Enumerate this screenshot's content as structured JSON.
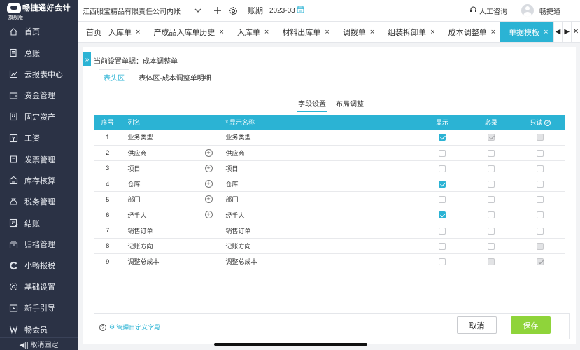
{
  "brand": {
    "name": "畅捷通好会计",
    "edition": "旗舰版"
  },
  "sidebar": {
    "items": [
      {
        "label": "首页",
        "icon": "home-icon"
      },
      {
        "label": "总账",
        "icon": "ledger-icon"
      },
      {
        "label": "云报表中心",
        "icon": "chart-icon"
      },
      {
        "label": "资金管理",
        "icon": "wallet-icon"
      },
      {
        "label": "固定资产",
        "icon": "building-icon"
      },
      {
        "label": "工资",
        "icon": "salary-icon"
      },
      {
        "label": "发票管理",
        "icon": "invoice-icon"
      },
      {
        "label": "库存核算",
        "icon": "warehouse-icon"
      },
      {
        "label": "税务管理",
        "icon": "tax-icon"
      },
      {
        "label": "结账",
        "icon": "checkout-icon"
      },
      {
        "label": "归档管理",
        "icon": "archive-icon"
      },
      {
        "label": "小畅报税",
        "icon": "c-logo-icon"
      },
      {
        "label": "基础设置",
        "icon": "gear-icon"
      },
      {
        "label": "新手引导",
        "icon": "guide-icon"
      },
      {
        "label": "畅会员",
        "icon": "member-icon"
      }
    ],
    "collapse_label": "◀|| 取消固定"
  },
  "header": {
    "company": "江西服宝精品有限责任公司内账",
    "period_label": "账期",
    "period_value": "2023-03",
    "support_label": "人工咨询",
    "username": "畅捷通"
  },
  "tabs": [
    {
      "label": "首页",
      "closable": false,
      "active": false
    },
    {
      "label": "入库单",
      "closable": true,
      "active": false,
      "clipped": true
    },
    {
      "label": "产成品入库单历史",
      "closable": true,
      "active": false
    },
    {
      "label": "入库单",
      "closable": true,
      "active": false
    },
    {
      "label": "材料出库单",
      "closable": true,
      "active": false
    },
    {
      "label": "调拨单",
      "closable": true,
      "active": false
    },
    {
      "label": "组装拆卸单",
      "closable": true,
      "active": false
    },
    {
      "label": "成本调整单",
      "closable": true,
      "active": false
    },
    {
      "label": "单据模板",
      "closable": true,
      "active": true
    }
  ],
  "panel": {
    "current_setting": "当前设置单据：成本调整单",
    "subtabs": [
      "表头区",
      "表体区-成本调整单明细"
    ],
    "modetabs": [
      "字段设置",
      "布局调整"
    ],
    "columns": [
      "序号",
      "列名",
      "显示名称",
      "显示",
      "必录",
      "只读"
    ],
    "rows": [
      {
        "no": "1",
        "name": "业务类型",
        "display": "业务类型",
        "plus": false,
        "show": "on",
        "required": "dis-on",
        "readonly": "dis"
      },
      {
        "no": "2",
        "name": "供应商",
        "display": "供应商",
        "plus": true,
        "show": "off",
        "required": "off",
        "readonly": "off"
      },
      {
        "no": "3",
        "name": "项目",
        "display": "项目",
        "plus": true,
        "show": "off",
        "required": "off",
        "readonly": "off"
      },
      {
        "no": "4",
        "name": "仓库",
        "display": "仓库",
        "plus": true,
        "show": "on",
        "required": "off",
        "readonly": "off"
      },
      {
        "no": "5",
        "name": "部门",
        "display": "部门",
        "plus": true,
        "show": "off",
        "required": "off",
        "readonly": "off"
      },
      {
        "no": "6",
        "name": "经手人",
        "display": "经手人",
        "plus": true,
        "show": "on",
        "required": "off",
        "readonly": "off"
      },
      {
        "no": "7",
        "name": "销售订单",
        "display": "销售订单",
        "plus": false,
        "show": "off",
        "required": "off",
        "readonly": "off"
      },
      {
        "no": "8",
        "name": "记账方向",
        "display": "记账方向",
        "plus": false,
        "show": "off",
        "required": "off",
        "readonly": "dis"
      },
      {
        "no": "9",
        "name": "调整总成本",
        "display": "调整总成本",
        "plus": false,
        "show": "off",
        "required": "dis",
        "readonly": "dis-on"
      }
    ],
    "manage_link": "管理自定义字段",
    "cancel_label": "取消",
    "save_label": "保存"
  },
  "colors": {
    "accent": "#2bb3d4",
    "save": "#8fd43a",
    "sidebar": "#2b3245"
  }
}
